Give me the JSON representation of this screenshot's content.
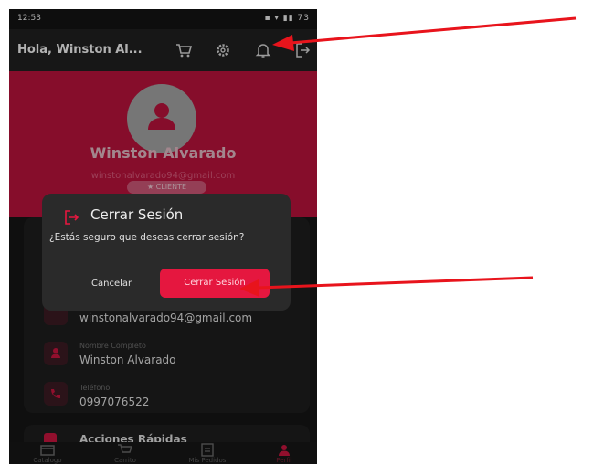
{
  "status_bar": {
    "time": "12:53",
    "system_icons": "▪ ▾ ▮▮ 73"
  },
  "app_bar": {
    "greeting": "Hola, Winston  Al..."
  },
  "profile": {
    "name": "Winston  Alvarado",
    "email": "winstonalvarado94@gmail.com",
    "role_badge": "★  CLIENTE"
  },
  "info_card": {
    "email_value": "winstonalvarado94@gmail.com",
    "name_label": "Nombre Completo",
    "name_value": "Winston  Alvarado",
    "phone_label": "Teléfono",
    "phone_value": "0997076522"
  },
  "quick_actions": {
    "title": "Acciones Rápidas"
  },
  "dialog": {
    "title": "Cerrar Sesión",
    "message": "¿Estás seguro que deseas cerrar sesión?",
    "cancel_label": "Cancelar",
    "confirm_label": "Cerrar Sesión"
  },
  "bottom_nav": {
    "items": [
      {
        "label": "Catalogo",
        "icon": "store-icon"
      },
      {
        "label": "Carrito",
        "icon": "cart-icon"
      },
      {
        "label": "Mis Pedidos",
        "icon": "orders-icon"
      },
      {
        "label": "Perfil",
        "icon": "person-icon",
        "active": true
      }
    ]
  },
  "colors": {
    "brand_red": "#b3123a",
    "button_red": "#e5173f",
    "background": "#141414",
    "annotation_arrow": "#e8141c"
  }
}
